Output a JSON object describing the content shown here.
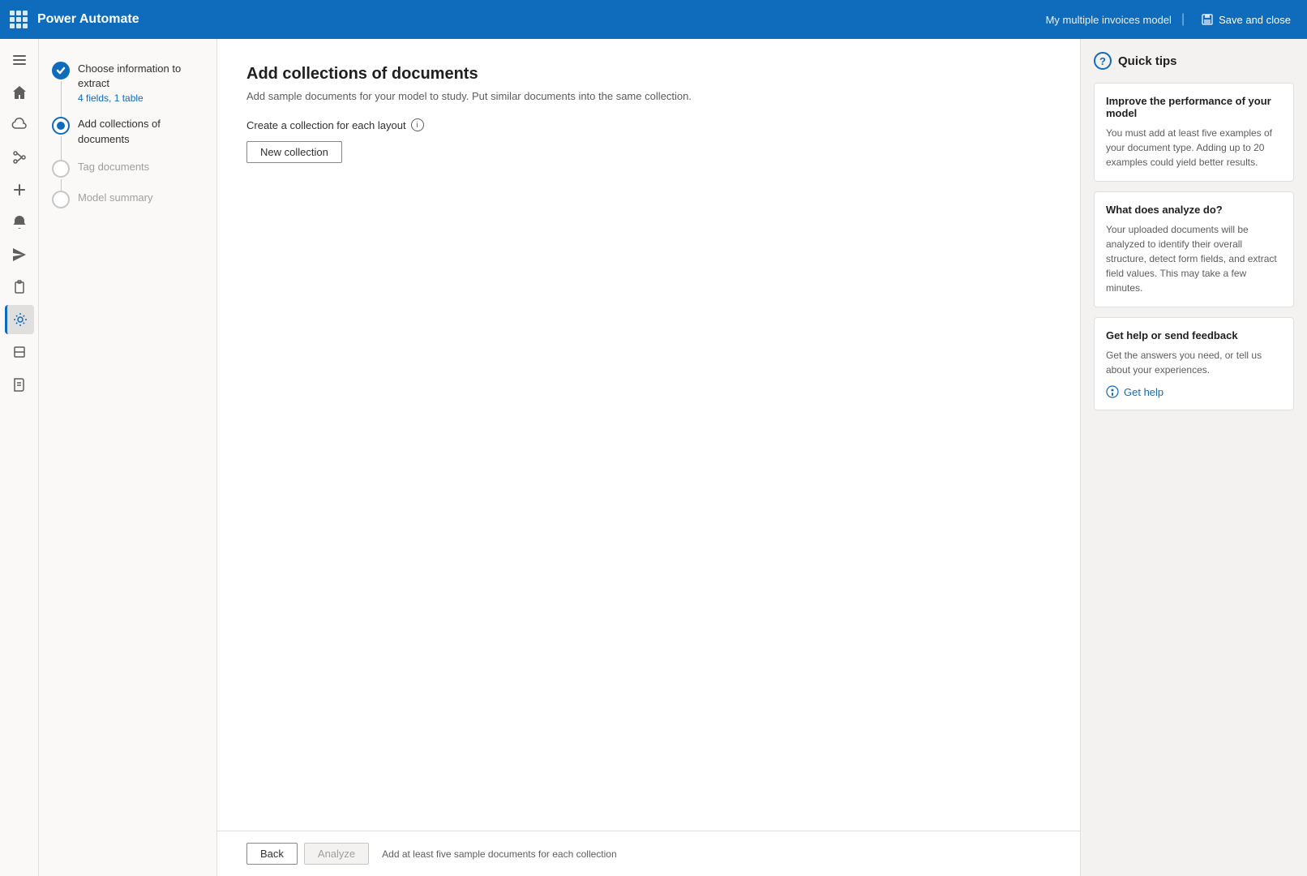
{
  "topbar": {
    "app_name": "Power Automate",
    "model_name": "My multiple invoices model",
    "save_close_label": "Save and close",
    "separator": "|"
  },
  "sidebar_icons": [
    {
      "name": "menu-icon",
      "unicode": "☰",
      "active": false
    },
    {
      "name": "home-icon",
      "active": false
    },
    {
      "name": "cloud-icon",
      "active": false
    },
    {
      "name": "flow-icon",
      "active": false
    },
    {
      "name": "add-icon",
      "active": false
    },
    {
      "name": "alert-icon",
      "active": false
    },
    {
      "name": "send-icon",
      "active": false
    },
    {
      "name": "clipboard-icon",
      "active": false
    },
    {
      "name": "ai-model-icon",
      "active": true
    },
    {
      "name": "scan-icon",
      "active": false
    },
    {
      "name": "book-icon",
      "active": false
    }
  ],
  "steps": [
    {
      "id": "step-1",
      "name": "Choose information to extract",
      "sub_label": "4 fields, 1 table",
      "state": "completed"
    },
    {
      "id": "step-2",
      "name": "Add collections of documents",
      "sub_label": "",
      "state": "active"
    },
    {
      "id": "step-3",
      "name": "Tag documents",
      "sub_label": "",
      "state": "inactive"
    },
    {
      "id": "step-4",
      "name": "Model summary",
      "sub_label": "",
      "state": "inactive"
    }
  ],
  "content": {
    "title": "Add collections of documents",
    "subtitle": "Add sample documents for your model to study. Put similar documents into the same collection.",
    "section_label": "Create a collection for each layout",
    "new_collection_btn": "New collection",
    "info_icon_label": "?"
  },
  "bottom_bar": {
    "back_label": "Back",
    "analyze_label": "Analyze",
    "hint": "Add at least five sample documents for each collection"
  },
  "quick_tips": {
    "title": "Quick tips",
    "cards": [
      {
        "title": "Improve the performance of your model",
        "text": "You must add at least five examples of your document type. Adding up to 20 examples could yield better results."
      },
      {
        "title": "What does analyze do?",
        "text": "Your uploaded documents will be analyzed to identify their overall structure, detect form fields, and extract field values. This may take a few minutes."
      },
      {
        "title": "Get help or send feedback",
        "text": "Get the answers you need, or tell us about your experiences.",
        "link_label": "Get help"
      }
    ]
  }
}
